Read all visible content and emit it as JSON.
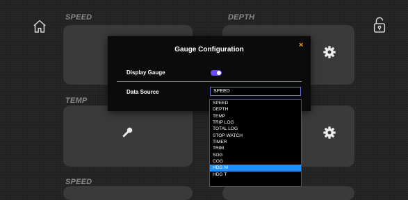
{
  "sidebar": {
    "left_icon": "home-icon",
    "right_icon": "unlock-icon"
  },
  "tiles": {
    "speed_top_label": "SPEED",
    "depth_label": "DEPTH",
    "temp_label": "TEMP",
    "speed_bottom_label": "SPEED"
  },
  "tile_icons": {
    "settings": "gear-icon",
    "tools": "wrench-icon"
  },
  "modal": {
    "title": "Gauge Configuration",
    "close": "×",
    "display_gauge_label": "Display Gauge",
    "display_gauge_on": true,
    "data_source_label": "Data Source",
    "data_source_value": "SPEED",
    "options": [
      "SPEED",
      "DEPTH",
      "TEMP",
      "TRIP LOG",
      "TOTAL LOG",
      "STOP WATCH",
      "TIMER",
      "TRIM",
      "SOG",
      "COG",
      "HDG M",
      "HDG T"
    ],
    "highlighted_option": "HDG M"
  },
  "colors": {
    "accent": "#6a4cff",
    "close": "#ff9800",
    "highlight": "#1e90ff",
    "tile": "#3a3a3a"
  }
}
